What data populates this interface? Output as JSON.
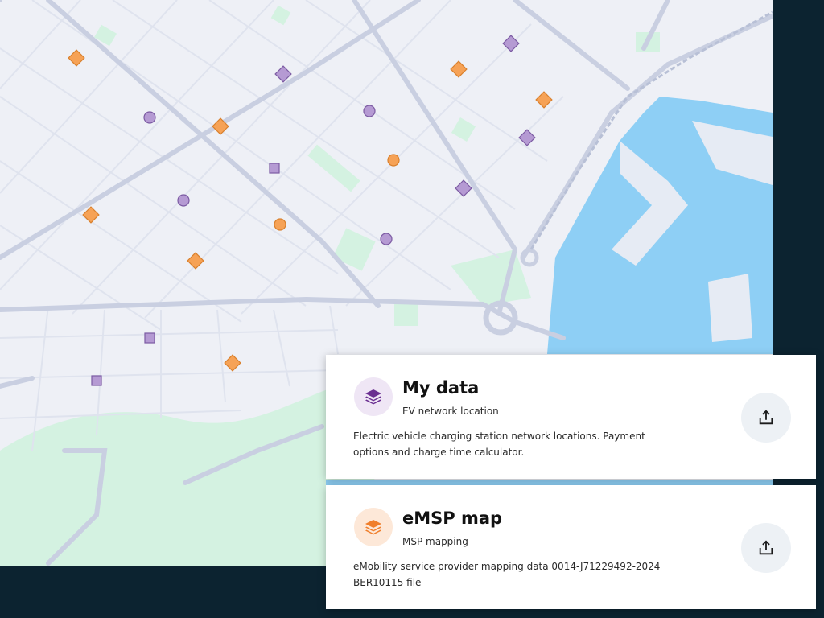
{
  "colors": {
    "background": "#0c2330",
    "map_land": "#eef0f6",
    "water": "#8ecff5",
    "park": "#d4f2e1",
    "road": "#c9cfe1",
    "marker_orange": "#f6a256",
    "marker_purple": "#b59ad3",
    "accent_purple": "#6a2e91",
    "accent_orange": "#f07f2c"
  },
  "map": {
    "legend_hint": "Markers: orange diamonds and circles, purple diamonds, circles and squares",
    "markers": [
      {
        "shape": "diamond",
        "color": "orange"
      },
      {
        "shape": "diamond",
        "color": "purple"
      },
      {
        "shape": "circle",
        "color": "purple"
      },
      {
        "shape": "square",
        "color": "purple"
      },
      {
        "shape": "circle",
        "color": "orange"
      }
    ]
  },
  "cards": [
    {
      "title": "My data",
      "subtitle": "EV network location",
      "description": "Electric vehicle charging station network locations. Payment options and charge time calculator.",
      "icon": "layers-icon",
      "icon_color": "#6a2e91",
      "icon_bg": "#efe6f5"
    },
    {
      "title": "eMSP map",
      "subtitle": "MSP mapping",
      "description": "eMobility service provider mapping data 0014-J71229492-2024 BER10115 file",
      "icon": "layers-icon",
      "icon_color": "#f07f2c",
      "icon_bg": "#fde8d8"
    }
  ],
  "share_icon": "share-icon"
}
